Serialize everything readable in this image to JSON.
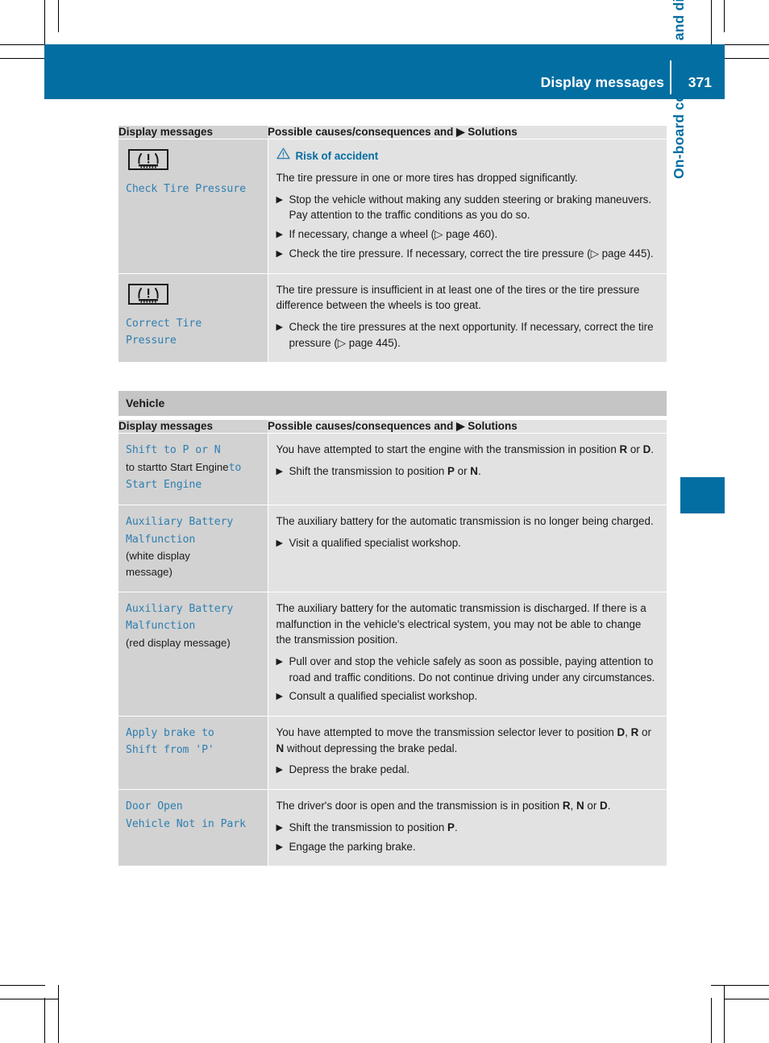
{
  "header": {
    "title": "Display messages",
    "page_number": "371"
  },
  "side_tab": {
    "label": "On-board computer and displays"
  },
  "table_headers": {
    "col1": "Display messages",
    "col2": "Possible causes/consequences and ▶ Solutions"
  },
  "icons": {
    "tire_pressure": "tire-pressure-warning-icon",
    "warning_triangle": "warning-triangle-icon",
    "step_marker": "▶",
    "page_ref_marker": "▷"
  },
  "section_vehicle": {
    "band_label": "Vehicle"
  },
  "table1": {
    "rows": [
      {
        "message": "Check Tire Pressure",
        "has_icon": true,
        "warning": "Risk of accident",
        "cause": "The tire pressure in one or more tires has dropped significantly.",
        "steps": [
          "Stop the vehicle without making any sudden steering or braking maneuvers. Pay attention to the traffic conditions as you do so.",
          "If necessary, change a wheel (▷ page 460).",
          "Check the tire pressure. If necessary, correct the tire pressure (▷ page 445)."
        ]
      },
      {
        "message_line1": "Correct Tire",
        "message_line2": "Pressure",
        "has_icon": true,
        "cause": "The tire pressure is insufficient in at least one of the tires or the tire pressure difference between the wheels is too great.",
        "steps": [
          "Check the tire pressures at the next opportunity. If necessary, correct the tire pressure (▷ page 445)."
        ]
      }
    ]
  },
  "table2": {
    "rows": [
      {
        "msg_blue_1": "Shift to P or N",
        "msg_black_1": "to start",
        "msg_black_2": "to Start Engine",
        "msg_blue_2": "to Start Engine",
        "cause_pre": "You have attempted to start the engine with the transmission in position ",
        "cause_b1": "R",
        "cause_mid": " or ",
        "cause_b2": "D",
        "cause_post": ".",
        "step_pre": "Shift the transmission to position ",
        "step_b1": "P",
        "step_mid": " or ",
        "step_b2": "N",
        "step_post": "."
      },
      {
        "msg_line1": "Auxiliary Battery",
        "msg_line2": "Malfunction",
        "note_line1": "(white display",
        "note_line2": "message)",
        "cause": "The auxiliary battery for the automatic transmission is no longer being charged.",
        "steps": [
          "Visit a qualified specialist workshop."
        ]
      },
      {
        "msg_line1": "Auxiliary Battery",
        "msg_line2": "Malfunction",
        "note_line1": "(red display message)",
        "cause": "The auxiliary battery for the automatic transmission is discharged. If there is a malfunction in the vehicle's electrical system, you may not be able to change the transmission position.",
        "steps": [
          "Pull over and stop the vehicle safely as soon as possible, paying attention to road and traffic conditions. Do not continue driving under any circumstances.",
          "Consult a qualified specialist workshop."
        ]
      },
      {
        "msg_line1": "Apply brake to",
        "msg_line2": "Shift from 'P'",
        "cause_pre": "You have attempted to move the transmission selector lever to position ",
        "cause_b1": "D",
        "cause_sep1": ", ",
        "cause_b2": "R",
        "cause_mid": " or ",
        "cause_b3": "N",
        "cause_post": " without depressing the brake pedal.",
        "steps": [
          "Depress the brake pedal."
        ]
      },
      {
        "msg_line1": "Door Open",
        "msg_line2": "Vehicle Not in Park",
        "cause_pre": "The driver's door is open and the transmission is in position ",
        "cause_b1": "R",
        "cause_sep1": ", ",
        "cause_b2": "N",
        "cause_mid": " or ",
        "cause_b3": "D",
        "cause_post": ".",
        "step1_pre": "Shift the transmission to position ",
        "step1_b": "P",
        "step1_post": ".",
        "step2": "Engage the parking brake."
      }
    ]
  },
  "colors": {
    "brand_blue": "#036ea1",
    "message_blue": "#2e7fb0",
    "col1_gray": "#d2d2d2",
    "col2_gray": "#e2e2e2",
    "band_gray": "#c5c5c5"
  }
}
